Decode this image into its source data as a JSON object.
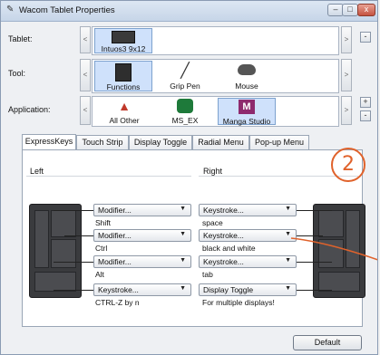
{
  "window": {
    "title": "Wacom Tablet Properties",
    "min": "–",
    "max": "□",
    "close": "x"
  },
  "tablet": {
    "label": "Tablet:",
    "items": [
      {
        "name": "Intuos3 9x12"
      }
    ]
  },
  "tool": {
    "label": "Tool:",
    "items": [
      {
        "name": "Functions"
      },
      {
        "name": "Grip Pen"
      },
      {
        "name": "Mouse"
      }
    ]
  },
  "application": {
    "label": "Application:",
    "items": [
      {
        "name": "All Other"
      },
      {
        "name": "MS_EX"
      },
      {
        "name": "Manga Studio"
      }
    ]
  },
  "side_buttons": {
    "add": "+",
    "remove": "-"
  },
  "arrows": {
    "left": "<",
    "right": ">"
  },
  "tabs": [
    "ExpressKeys",
    "Touch Strip",
    "Display Toggle",
    "Radial Menu",
    "Pop-up Menu"
  ],
  "panel": {
    "left_label": "Left",
    "right_label": "Right",
    "left_keys": [
      {
        "value": "Modifier...",
        "sub": "Shift"
      },
      {
        "value": "Modifier...",
        "sub": "Ctrl"
      },
      {
        "value": "Modifier...",
        "sub": "Alt"
      },
      {
        "value": "Keystroke...",
        "sub": "CTRL-Z by n"
      }
    ],
    "right_keys": [
      {
        "value": "Keystroke...",
        "sub": "space"
      },
      {
        "value": "Keystroke...",
        "sub": "black and white"
      },
      {
        "value": "Keystroke...",
        "sub": "tab"
      },
      {
        "value": "Display Toggle",
        "sub": "For multiple displays!"
      }
    ]
  },
  "default_button": "Default",
  "annotation": {
    "text": "2",
    "color": "#e0622b"
  },
  "colors": {
    "selected_item": "#cfe1fb",
    "titlebar": "#c6d5e8"
  }
}
